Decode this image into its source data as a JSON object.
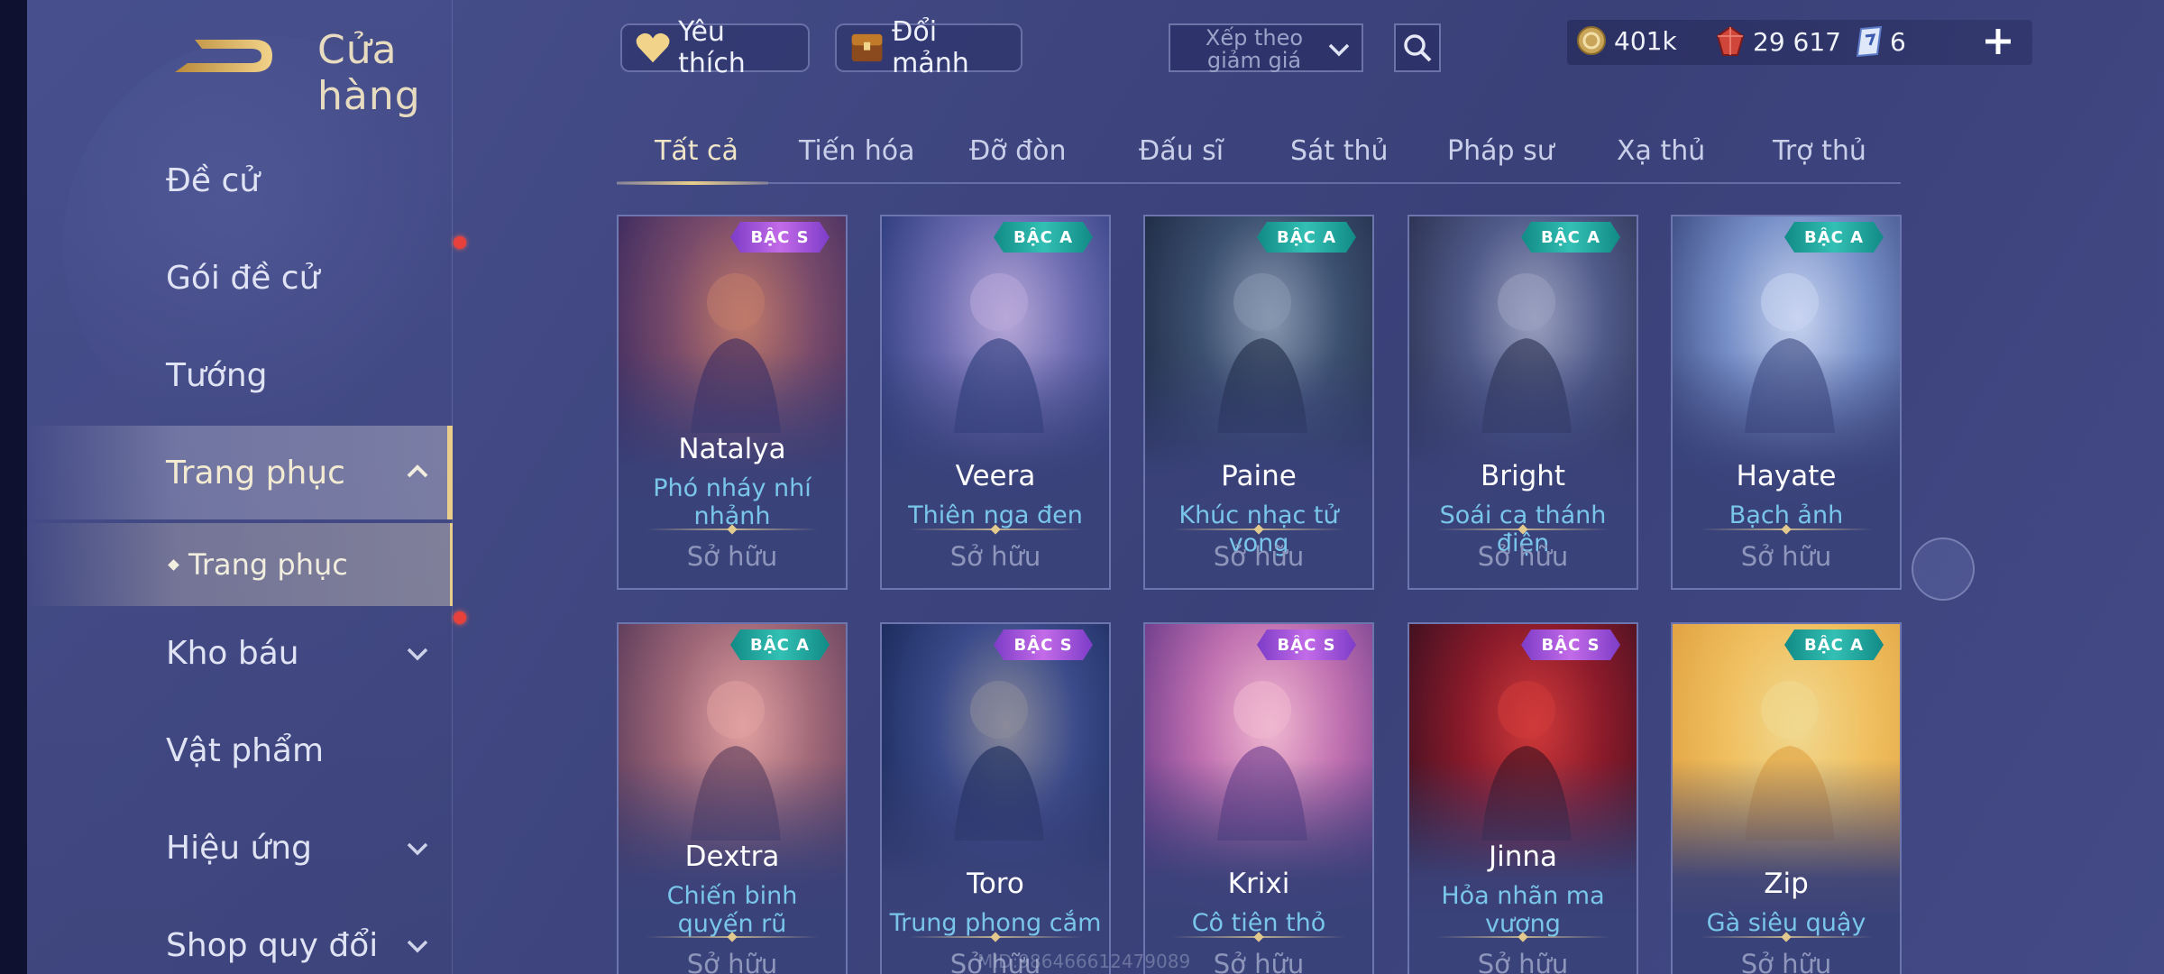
{
  "header": {
    "title": "Cửa hàng",
    "favorites_label": "Yêu thích",
    "exchange_label": "Đổi mảnh",
    "sort_label": "Xếp theo giảm giá",
    "currencies": [
      {
        "icon": "gold-coin-icon",
        "value": "401k"
      },
      {
        "icon": "ruby-gem-icon",
        "value": "29 617"
      },
      {
        "icon": "voucher-icon",
        "value": "6"
      }
    ]
  },
  "sidebar": {
    "items": [
      {
        "label": "Đề cử"
      },
      {
        "label": "Gói đề cử"
      },
      {
        "label": "Tướng"
      },
      {
        "label": "Trang phục"
      },
      {
        "label": "Trang phục"
      },
      {
        "label": "Kho báu"
      },
      {
        "label": "Vật phẩm"
      },
      {
        "label": "Hiệu ứng"
      },
      {
        "label": "Shop quy đổi"
      }
    ]
  },
  "tabs": [
    "Tất cả",
    "Tiến hóa",
    "Đỡ đòn",
    "Đấu sĩ",
    "Sát thủ",
    "Pháp sư",
    "Xạ thủ",
    "Trợ thủ"
  ],
  "cards": [
    {
      "hero": "Natalya",
      "skin": "Phó nháy nhí nhảnh",
      "tier": "BẬC S",
      "status": "Sở hữu",
      "colors": [
        "#3a2a60",
        "#7a4b6a",
        "#c07a6a"
      ]
    },
    {
      "hero": "Veera",
      "skin": "Thiên nga đen",
      "tier": "BẬC A",
      "status": "Sở hữu",
      "colors": [
        "#2a3a7a",
        "#6a6ab0",
        "#b8a8d8"
      ]
    },
    {
      "hero": "Paine",
      "skin": "Khúc nhạc tử vong",
      "tier": "BẬC A",
      "status": "Sở hữu",
      "colors": [
        "#1e2a44",
        "#3c5070",
        "#8898b0"
      ]
    },
    {
      "hero": "Bright",
      "skin": "Soái ca thánh điện",
      "tier": "BẬC A",
      "status": "Sở hữu",
      "colors": [
        "#2a3050",
        "#505a88",
        "#9aa0c0"
      ]
    },
    {
      "hero": "Hayate",
      "skin": "Bạch ảnh",
      "tier": "BẬC A",
      "status": "Sở hữu",
      "colors": [
        "#3a4a80",
        "#7890c8",
        "#c8d4f0"
      ]
    },
    {
      "hero": "Dextra",
      "skin": "Chiến binh quyến rũ",
      "tier": "BẬC A",
      "status": "Sở hữu",
      "colors": [
        "#5a3a5a",
        "#a06878",
        "#e0a0a0"
      ]
    },
    {
      "hero": "Toro",
      "skin": "Trung phong cắm",
      "tier": "BẬC S",
      "status": "Sở hữu",
      "colors": [
        "#1a2a5a",
        "#3a4a8a",
        "#8a8a9a"
      ]
    },
    {
      "hero": "Krixi",
      "skin": "Cô tiên thỏ",
      "tier": "BẬC S",
      "status": "Sở hữu",
      "colors": [
        "#6a3a8a",
        "#c070b0",
        "#f0b8d0"
      ]
    },
    {
      "hero": "Jinna",
      "skin": "Hỏa nhãn ma vương",
      "tier": "BẬC S",
      "status": "Sở hữu",
      "colors": [
        "#3a1020",
        "#8a1a2a",
        "#d03a3a"
      ]
    },
    {
      "hero": "Zip",
      "skin": "Gà siêu quậy",
      "tier": "BẬC A",
      "status": "Sở hữu",
      "colors": [
        "#e0a040",
        "#f0c060",
        "#f0d890"
      ]
    }
  ],
  "watermark": "MID:986466612479089",
  "colors": {
    "accent_gold": "#e9cf8b",
    "skin_name": "#79c6ea",
    "tier_s": "#a04fd8",
    "tier_a": "#22a8a0",
    "notification": "#e8403a"
  }
}
